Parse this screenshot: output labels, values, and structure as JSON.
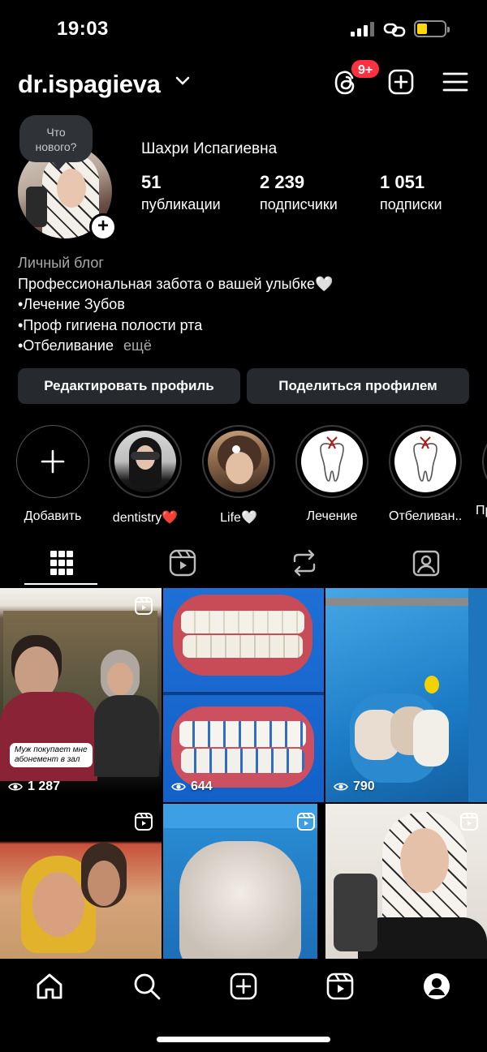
{
  "status_bar": {
    "time": "19:03"
  },
  "header": {
    "username": "dr.ispagieva",
    "notification_badge": "9+"
  },
  "profile": {
    "note_bubble": "Что\nнового?",
    "full_name": "Шахри Испагиевна",
    "stats": [
      {
        "value": "51",
        "label": "публикации"
      },
      {
        "value": "2 239",
        "label": "подписчики"
      },
      {
        "value": "1 051",
        "label": "подписки"
      }
    ],
    "category": "Личный блог",
    "bio_lines": [
      "Профессиональная забота о вашей улыбке🤍",
      "•Лечение Зубов",
      "•Проф гигиена полости рта",
      "•Отбеливание"
    ],
    "more": "ещё"
  },
  "buttons": {
    "edit": "Редактировать профиль",
    "share": "Поделиться профилем"
  },
  "highlights": [
    {
      "label": "Добавить"
    },
    {
      "label": "dentistry❤️"
    },
    {
      "label": "Life🤍"
    },
    {
      "label": "Лечение"
    },
    {
      "label": "Отбеливан..."
    },
    {
      "label": "Пр"
    }
  ],
  "grid": [
    {
      "views": "1 287",
      "caption": "Муж покупает мне абонемент в зал",
      "is_reel": true
    },
    {
      "views": "644",
      "is_reel": false
    },
    {
      "views": "790",
      "is_reel": false
    },
    {
      "is_reel": true
    },
    {
      "is_reel": true
    },
    {
      "is_reel": true
    }
  ],
  "colors": {
    "background": "#000000",
    "badge": "#ff3040",
    "button": "#262a2f",
    "battery": "#ffd60a"
  }
}
